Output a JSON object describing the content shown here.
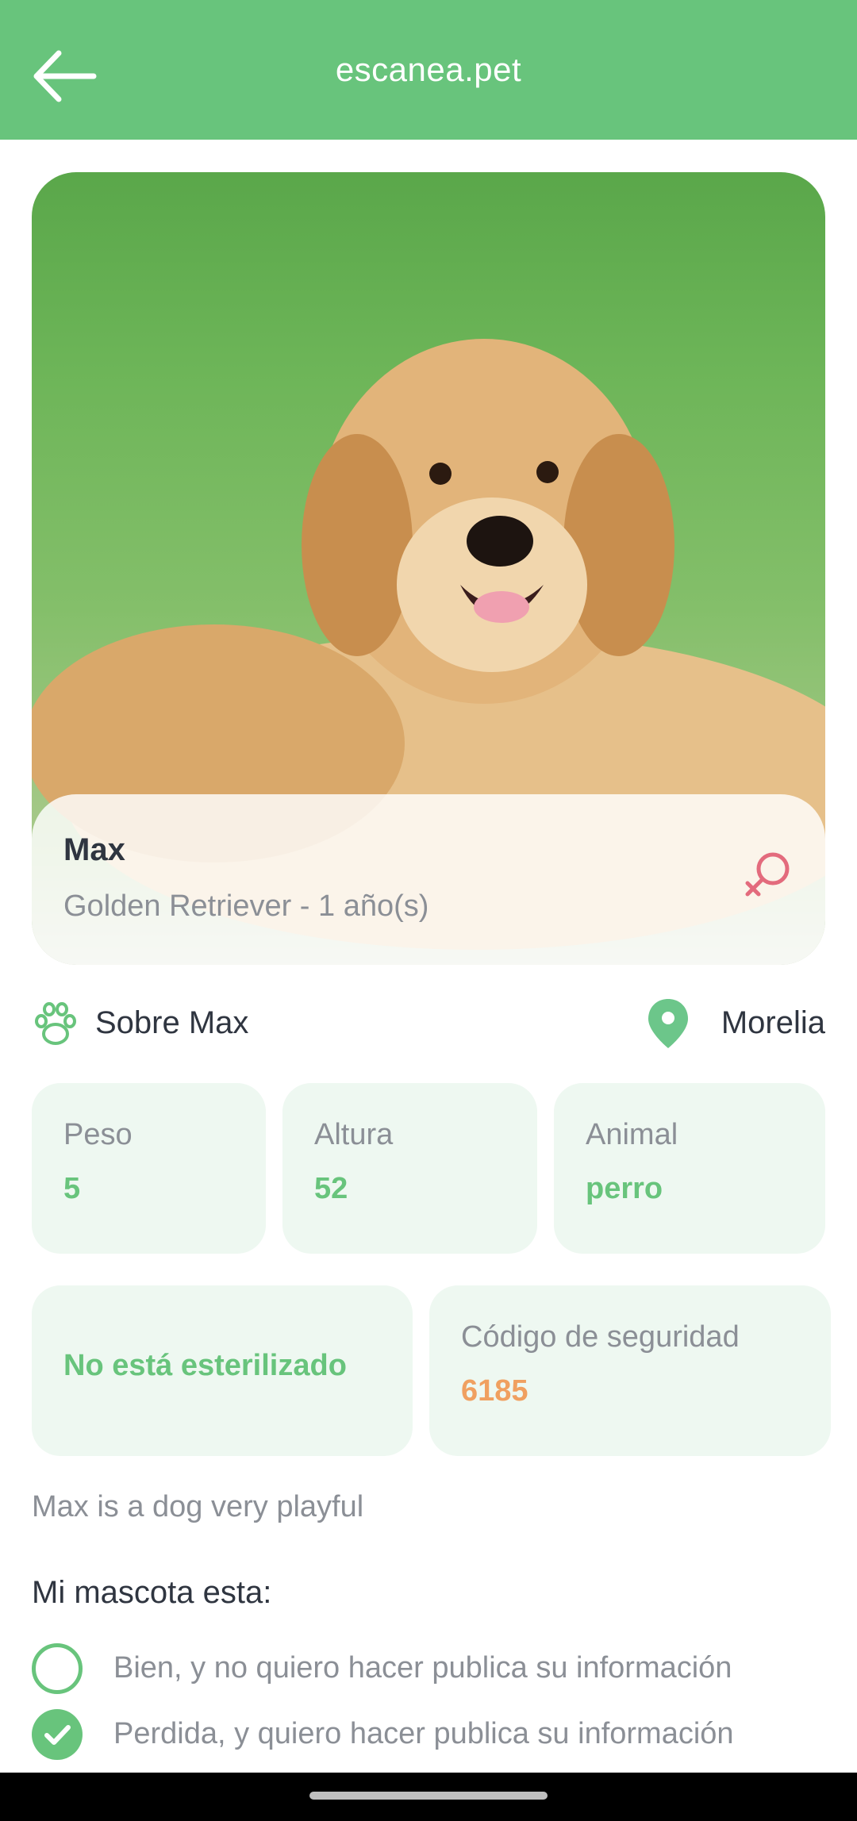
{
  "appbar": {
    "title": "escanea.pet",
    "back_icon": "arrow-left-icon"
  },
  "pet": {
    "name": "Max",
    "subtitle": "Golden Retriever - 1 año(s)",
    "gender_icon": "female-icon"
  },
  "about": {
    "label": "Sobre Max",
    "icon": "paw-icon",
    "location_icon": "map-pin-icon",
    "location": "Morelia"
  },
  "stats": [
    {
      "label": "Peso",
      "value": "5"
    },
    {
      "label": "Altura",
      "value": "52"
    },
    {
      "label": "Animal",
      "value": "perro"
    }
  ],
  "sterilization": "No está esterilizado",
  "security": {
    "label": "Código de seguridad",
    "code": "6185"
  },
  "description": "Max is a dog very playful",
  "status": {
    "heading": "Mi mascota esta:",
    "options": [
      {
        "label": "Bien, y no quiero hacer publica su información",
        "checked": false
      },
      {
        "label": "Perdida, y quiero hacer publica su información",
        "checked": true
      }
    ]
  },
  "colors": {
    "primary": "#68c47c",
    "card_bg": "#eef8f1",
    "accent_code": "#f0a060",
    "female": "#e36b7d"
  }
}
